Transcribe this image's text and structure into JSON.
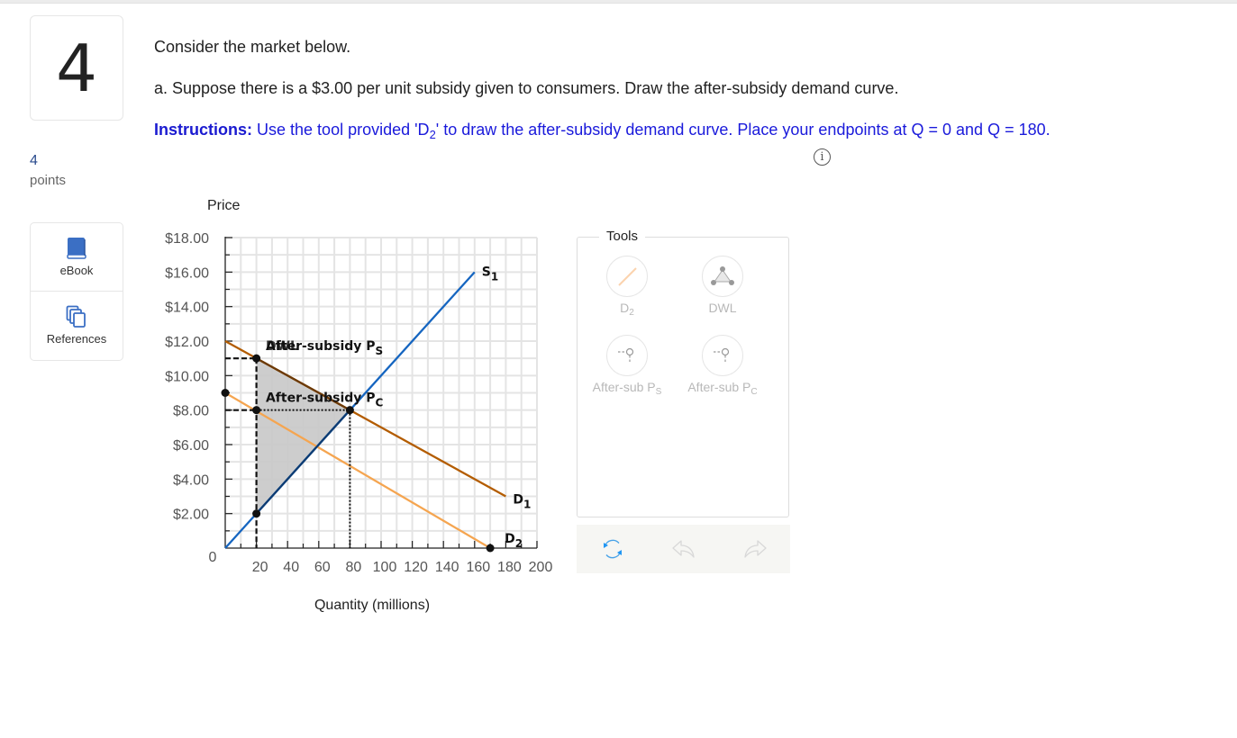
{
  "question": {
    "number": "4",
    "points_value": "4",
    "points_label": "points",
    "intro": "Consider the market below.",
    "part_a": "a. Suppose there is a $3.00 per unit subsidy given to consumers. Draw the after-subsidy demand curve.",
    "instructions_label": "Instructions:",
    "instructions_pre": " Use the tool provided 'D",
    "instructions_sub": "2",
    "instructions_post": "' to draw the after-subsidy demand curve. Place your endpoints at Q = 0 and Q = 180.",
    "info_icon": "i"
  },
  "resources": [
    {
      "label": "eBook",
      "icon": "book-icon"
    },
    {
      "label": "References",
      "icon": "documents-icon"
    }
  ],
  "colors": {
    "supply": "#1565c0",
    "demand1": "#b35c00",
    "demand2": "#f5a550",
    "dwl_fill": "#c8c8c8",
    "grid": "#e4e4e4",
    "tick_label": "#555555",
    "refresh": "#2196f3"
  },
  "chart_data": {
    "type": "line",
    "title": "",
    "xlabel": "Quantity (millions)",
    "ylabel": "Price",
    "xlim": [
      0,
      200
    ],
    "ylim": [
      0,
      18
    ],
    "grid": true,
    "x_ticks": [
      "20",
      "40",
      "60",
      "80",
      "100",
      "120",
      "140",
      "160",
      "180",
      "200"
    ],
    "x_tick_values": [
      20,
      40,
      60,
      80,
      100,
      120,
      140,
      160,
      180,
      200
    ],
    "y_ticks": [
      "$2.00",
      "$4.00",
      "$6.00",
      "$8.00",
      "$10.00",
      "$12.00",
      "$14.00",
      "$16.00",
      "$18.00"
    ],
    "y_tick_values": [
      2,
      4,
      6,
      8,
      10,
      12,
      14,
      16,
      18
    ],
    "origin_label": "0",
    "series": [
      {
        "name": "S",
        "sub": "1",
        "key": "supply",
        "points": [
          [
            0,
            0
          ],
          [
            160,
            16
          ]
        ]
      },
      {
        "name": "D",
        "sub": "1",
        "key": "demand1",
        "points": [
          [
            0,
            12
          ],
          [
            180,
            3
          ]
        ]
      },
      {
        "name": "D",
        "sub": "2",
        "key": "demand2",
        "points": [
          [
            0,
            9
          ],
          [
            170,
            0
          ]
        ],
        "endpoints_marked": true
      }
    ],
    "dwl_polygon": {
      "label": "DWL",
      "points": [
        [
          20,
          11
        ],
        [
          80,
          8
        ],
        [
          20,
          2
        ]
      ]
    },
    "markers": [
      [
        20,
        11
      ],
      [
        20,
        8
      ],
      [
        20,
        2
      ],
      [
        80,
        8
      ]
    ],
    "after_subsidy_ps": {
      "label": "After-subsidy P",
      "sub": "S",
      "price": 11,
      "quantity": 20
    },
    "after_subsidy_pc": {
      "label": "After-subsidy P",
      "sub": "C",
      "price": 8,
      "quantity": 80
    },
    "dashed_guides": [
      {
        "from": [
          0,
          11
        ],
        "to": [
          20,
          11
        ],
        "style": "dashed"
      },
      {
        "from": [
          0,
          8
        ],
        "to": [
          20,
          8
        ],
        "style": "dashed"
      },
      {
        "from": [
          20,
          11
        ],
        "to": [
          20,
          0
        ],
        "style": "dashed"
      },
      {
        "from": [
          20,
          8
        ],
        "to": [
          80,
          8
        ],
        "style": "dotted"
      },
      {
        "from": [
          80,
          8
        ],
        "to": [
          80,
          0
        ],
        "style": "dotted"
      }
    ]
  },
  "tools": {
    "legend": "Tools",
    "items": [
      {
        "label": "D",
        "sub": "2",
        "icon": "line-tool-icon"
      },
      {
        "label": "DWL",
        "sub": "",
        "icon": "polygon-tool-icon"
      },
      {
        "label": "After-sub P",
        "sub": "S",
        "icon": "point-tool-icon"
      },
      {
        "label": "After-sub P",
        "sub": "C",
        "icon": "point-tool-icon"
      }
    ]
  },
  "actions": [
    {
      "name": "reset",
      "icon": "refresh-icon"
    },
    {
      "name": "undo",
      "icon": "undo-icon"
    },
    {
      "name": "redo",
      "icon": "redo-icon"
    }
  ]
}
